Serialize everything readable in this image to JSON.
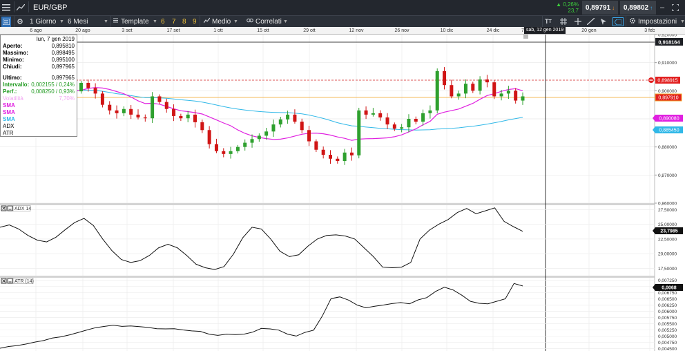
{
  "toolbar_top": {
    "symbol": "EUR/GBP",
    "change_pct": "0,26%",
    "change_pts": "23,7",
    "sell_price": "0,89791",
    "buy_price": "0,89802"
  },
  "toolbar": {
    "interval": "1 Giorno",
    "range": "6 Mesi",
    "template": "Template",
    "presets": [
      "6",
      "7",
      "8",
      "9"
    ],
    "indicator": "Medio",
    "related": "Correlati",
    "settings": "Impostazioni"
  },
  "date_axis": {
    "labels": [
      "6 ago",
      "20 ago",
      "3 set",
      "17 set",
      "1 ott",
      "15 ott",
      "29 ott",
      "12 nov",
      "26 nov",
      "10 dic",
      "24 dic",
      "7",
      "20 gen",
      "3 feb"
    ],
    "hover_date": "sab, 12 gen 2019"
  },
  "info": {
    "date": "lun, 7 gen 2019",
    "open_label": "Aperto:",
    "open": "0,895810",
    "high_label": "Massimo:",
    "high": "0,898495",
    "low_label": "Minimo:",
    "low": "0,895100",
    "close_label": "Chiudi:",
    "close": "0,897965",
    "last_label": "Ultimo:",
    "last": "0,897965",
    "range_label": "Intervallo:",
    "range": "0,002155 / 0,24%",
    "perf_label": "Perf.:",
    "perf": "0,008250 / 0,93%",
    "volatility_label": "Volatilità",
    "volatility": "7,70%",
    "ind": [
      "SMA",
      "SMA",
      "SMA",
      "ADX",
      "ATR"
    ]
  },
  "price_axis": {
    "ticks": [
      "0,920000",
      "0,910000",
      "0,900000",
      "0,890000",
      "0,880000",
      "0,870000",
      "0,860000"
    ],
    "crosshair": "0,918164",
    "red_line": "0,898915",
    "last": "0,897910",
    "sma_magenta": "0,890080",
    "sma_cyan": "0,885450"
  },
  "adx_panel": {
    "label": "ADX 14",
    "ticks": [
      "27,50000",
      "25,00000",
      "22,50000",
      "20,00000",
      "17,50000"
    ],
    "last": "23,7985"
  },
  "atr_panel": {
    "label": "ATR (14)",
    "ticks": [
      "0,007250",
      "0,007000",
      "0,006750",
      "0,006500",
      "0,006250",
      "0,006000",
      "0,005750",
      "0,005500",
      "0,005250",
      "0,005000",
      "0,004750",
      "0,004500"
    ],
    "last": "0,0068"
  },
  "colors": {
    "up": "#2ea02e",
    "down": "#d01515",
    "sma_magenta": "#e020e0",
    "sma_cyan": "#30b8e8",
    "last_line": "#f0a020",
    "red_dash": "#d42020"
  },
  "chart_data": [
    {
      "type": "candlestick",
      "title": "EUR/GBP",
      "x_range": [
        "6 ago 2018",
        "3 feb 2019"
      ],
      "ylim": [
        0.86,
        0.92
      ],
      "closes": [
        0.8932,
        0.8951,
        0.8972,
        0.899,
        0.901,
        0.903,
        0.9055,
        0.9065,
        0.902,
        0.897,
        0.8998,
        0.9028,
        0.901,
        0.899,
        0.895,
        0.893,
        0.892,
        0.8935,
        0.8915,
        0.8905,
        0.8902,
        0.898,
        0.896,
        0.8935,
        0.891,
        0.8902,
        0.8915,
        0.8888,
        0.886,
        0.881,
        0.8785,
        0.8775,
        0.8785,
        0.88,
        0.8815,
        0.8828,
        0.884,
        0.8855,
        0.888,
        0.8898,
        0.8915,
        0.889,
        0.886,
        0.882,
        0.879,
        0.8772,
        0.8758,
        0.875,
        0.878,
        0.877,
        0.893,
        0.8915,
        0.892,
        0.8905,
        0.888,
        0.8865,
        0.887,
        0.89,
        0.889,
        0.892,
        0.893,
        0.907,
        0.902,
        0.898,
        0.899,
        0.9025,
        0.9,
        0.904,
        0.903,
        0.898,
        0.899,
        0.9,
        0.8965,
        0.898
      ],
      "last": 0.897965
    },
    {
      "type": "line",
      "title": "ADX 14",
      "ylim": [
        16.25,
        28.25
      ],
      "values": [
        24.5,
        24.9,
        24.2,
        23.1,
        22.3,
        22.0,
        22.8,
        24.1,
        25.3,
        26.0,
        24.8,
        22.5,
        20.5,
        19.0,
        18.5,
        18.8,
        19.7,
        21.0,
        21.6,
        21.0,
        19.7,
        18.2,
        17.6,
        17.3,
        17.8,
        19.9,
        22.7,
        24.5,
        24.2,
        22.5,
        20.4,
        19.5,
        19.8,
        21.3,
        22.5,
        23.1,
        23.2,
        23.0,
        22.5,
        21.0,
        19.5,
        17.7,
        17.6,
        17.7,
        18.5,
        22.5,
        24.0,
        25.0,
        25.8,
        27.0,
        27.7,
        26.8,
        27.3,
        27.8,
        25.5,
        24.6,
        23.8
      ]
    },
    {
      "type": "line",
      "title": "ATR (14)",
      "ylim": [
        0.0044,
        0.00735
      ],
      "values": [
        0.00451,
        0.00458,
        0.00462,
        0.00468,
        0.00476,
        0.00482,
        0.00492,
        0.00497,
        0.00505,
        0.00515,
        0.00525,
        0.00534,
        0.00539,
        0.00544,
        0.00539,
        0.00541,
        0.00538,
        0.00535,
        0.0053,
        0.00529,
        0.0053,
        0.00525,
        0.00521,
        0.00519,
        0.00508,
        0.00503,
        0.00508,
        0.00506,
        0.00508,
        0.00516,
        0.00531,
        0.00529,
        0.00524,
        0.00508,
        0.005,
        0.00515,
        0.00524,
        0.00581,
        0.00651,
        0.00658,
        0.00645,
        0.00625,
        0.00614,
        0.0062,
        0.00625,
        0.00631,
        0.00635,
        0.0063,
        0.00646,
        0.00655,
        0.0068,
        0.00697,
        0.00686,
        0.00665,
        0.0064,
        0.00632,
        0.0063,
        0.0064,
        0.0065,
        0.00712,
        0.00702
      ]
    }
  ]
}
